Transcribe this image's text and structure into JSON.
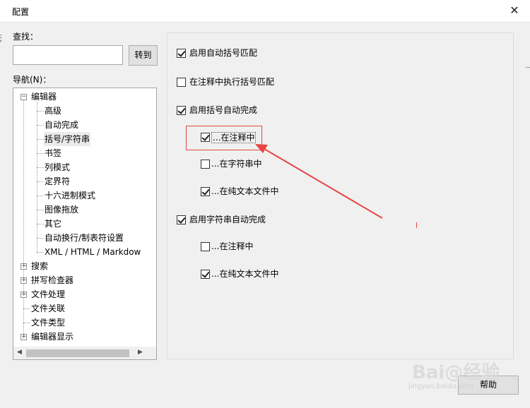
{
  "window": {
    "title": "配置",
    "close_icon": "close-icon"
  },
  "search": {
    "label": "查找：",
    "value": "",
    "button": "转到"
  },
  "nav": {
    "label": "导航(N)：",
    "items": [
      {
        "label": "编辑器",
        "level": 0,
        "expander": "−"
      },
      {
        "label": "高级",
        "level": 1
      },
      {
        "label": "自动完成",
        "level": 1
      },
      {
        "label": "括号/字符串",
        "level": 1,
        "selected": true
      },
      {
        "label": "书签",
        "level": 1
      },
      {
        "label": "列模式",
        "level": 1
      },
      {
        "label": "定界符",
        "level": 1
      },
      {
        "label": "十六进制模式",
        "level": 1
      },
      {
        "label": "图像拖放",
        "level": 1
      },
      {
        "label": "其它",
        "level": 1
      },
      {
        "label": "自动换行/制表符设置",
        "level": 1
      },
      {
        "label": "XML / HTML / Markdow",
        "level": 1
      },
      {
        "label": "搜索",
        "level": 0,
        "expander": "+"
      },
      {
        "label": "拼写检查器",
        "level": 0,
        "expander": "+"
      },
      {
        "label": "文件处理",
        "level": 0,
        "expander": "+"
      },
      {
        "label": "文件关联",
        "level": 0
      },
      {
        "label": "文件类型",
        "level": 0
      },
      {
        "label": "编辑器显示",
        "level": 0,
        "expander": "+"
      }
    ]
  },
  "options": {
    "auto_bracket_match": {
      "label": "启用自动括号匹配",
      "checked": true
    },
    "bracket_match_in_comments": {
      "label": "在注释中执行括号匹配",
      "checked": false
    },
    "bracket_autocomplete": {
      "label": "启用括号自动完成",
      "checked": true
    },
    "bracket_in_comments": {
      "label": "...在注释中",
      "checked": true
    },
    "bracket_in_strings": {
      "label": "...在字符串中",
      "checked": false
    },
    "bracket_in_plain_text": {
      "label": "...在纯文本文件中",
      "checked": true
    },
    "string_autocomplete": {
      "label": "启用字符串自动完成",
      "checked": true
    },
    "string_in_comments": {
      "label": "...在注释中",
      "checked": false
    },
    "string_in_plain_text": {
      "label": "...在纯文本文件中",
      "checked": true
    }
  },
  "footer": {
    "help_button": "帮助"
  },
  "watermark": {
    "brand": "Bai@经验",
    "url": "jingyan.baidu.com"
  },
  "colors": {
    "annotation_red": "#e64545"
  }
}
